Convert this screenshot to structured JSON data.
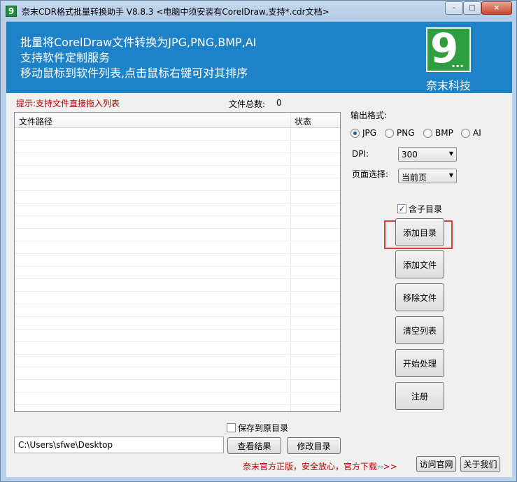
{
  "window": {
    "title": "奈末CDR格式批量转换助手   V8.8.3  <电脑中须安装有CorelDraw,支持*.cdr文档>",
    "icon_text": "9",
    "controls": {
      "minimize": "-",
      "maximize": "□",
      "close": "×"
    }
  },
  "banner": {
    "lines": [
      "批量将CorelDraw文件转换为JPG,PNG,BMP,AI",
      "支持软件定制服务",
      "移动鼠标到软件列表,点击鼠标右键可对其排序"
    ],
    "logo_digit": "9",
    "logo_dots": "...",
    "company": "奈末科技",
    "colors": {
      "banner": "#1e82c9",
      "logo": "#2f9e3f"
    }
  },
  "file_panel": {
    "hint": "提示:支持文件直接拖入列表",
    "count_label": "文件总数:",
    "count_value": "0",
    "columns": [
      "文件路径",
      "状态"
    ]
  },
  "options": {
    "format_label": "输出格式:",
    "formats": [
      "JPG",
      "PNG",
      "BMP",
      "AI"
    ],
    "selected_format": "JPG",
    "dpi_label": "DPI:",
    "dpi_value": "300",
    "page_label": "页面选择:",
    "page_value": "当前页",
    "include_subdir_label": "含子目录",
    "include_subdir_checked": true
  },
  "actions": {
    "add_dir": "添加目录",
    "add_file": "添加文件",
    "remove_file": "移除文件",
    "clear_list": "清空列表",
    "start": "开始处理",
    "register": "注册"
  },
  "output": {
    "save_to_source_label": "保存到原目录",
    "save_to_source_checked": false,
    "path": "C:\\Users\\sfwe\\Desktop",
    "view_result": "查看结果",
    "change_dir": "修改目录"
  },
  "footer": {
    "notice": "奈末官方正版，安全放心，官方下载-->>",
    "visit_site": "访问官网",
    "about": "关于我们"
  },
  "highlight_color": "#e03c3c"
}
